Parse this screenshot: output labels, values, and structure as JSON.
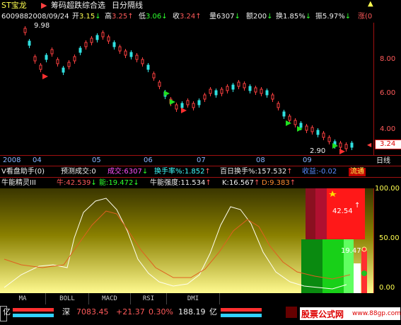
{
  "header": {
    "stock_name": "ST宝龙",
    "fav_icon": "arrow-icon",
    "title": "筹码超跌综合选",
    "period": "日分隔线",
    "code": "600988",
    "date": "2008/09/24",
    "open_label": "开",
    "open_value": "3.15",
    "high_label": "高",
    "high_value": "3.25",
    "low_label": "低",
    "low_value": "3.06",
    "close_label": "收",
    "close_value": "3.24",
    "volume_label": "量",
    "volume_value": "6307",
    "amount_label": "额",
    "amount_value": "200",
    "turnover_label": "换",
    "turnover_value": "1.85%",
    "amplitude_label": "振",
    "amplitude_value": "5.97%",
    "change_label": "涨",
    "change_value": "(0"
  },
  "price_chart": {
    "price_high_marker": "9.98",
    "price_low_marker": "2.90",
    "current_price_tag": "3.24",
    "y_ticks": [
      "8.00",
      "6.00",
      "4.00"
    ],
    "x_ticks": [
      "2008",
      "04",
      "05",
      "06",
      "07",
      "08",
      "09"
    ],
    "period_label": "日线"
  },
  "indicator1": {
    "name": "V看盘助手",
    "param": "(0)",
    "forecast_label": "预测成交:",
    "forecast_value": "0",
    "volume_label": "成交:",
    "volume_value": "6307",
    "turnover_label": "换手率%:",
    "turnover_value": "1.852",
    "hundred_label": "百日换手%:",
    "hundred_value": "157.532",
    "profit_label": "收益:",
    "profit_value": "-0.02",
    "flow_label": "流通"
  },
  "indicator2": {
    "name": "牛能精灵III",
    "cow_label": "牛:",
    "cow_value": "42.539",
    "energy_label": "能:",
    "energy_value": "19.472",
    "strength_label": "牛能强度:",
    "strength_value": "11.534",
    "k_label": "K:",
    "k_value": "16.567",
    "d_label": "D:",
    "d_value": "9.383",
    "y_ticks": [
      "100.00",
      "50.00",
      "0.00"
    ],
    "red_bar_value": "42.54",
    "green_bar_value": "19.47"
  },
  "tabs": [
    "MA",
    "BOLL",
    "MACD",
    "RSI",
    "DMI"
  ],
  "status": {
    "left_symbol": "亿",
    "market": "深",
    "index_value": "7083.45",
    "index_change": "+21.37",
    "index_pct": "0.30%",
    "turnover": "188.19",
    "turnover_unit": "亿",
    "watermark": "股票公式网",
    "watermark_url": "www.88gp.com"
  }
}
